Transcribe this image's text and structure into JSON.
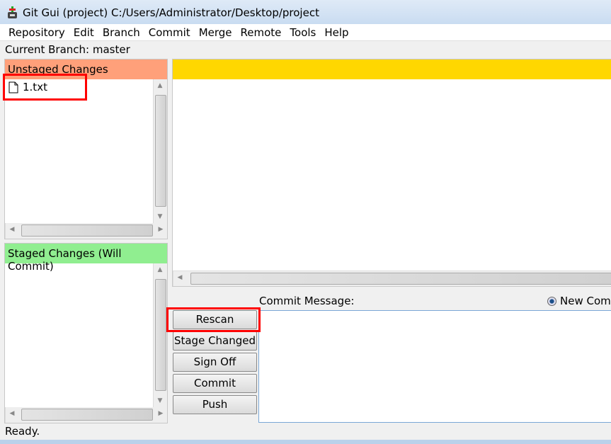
{
  "window": {
    "title": "Git Gui (project) C:/Users/Administrator/Desktop/project"
  },
  "menu": [
    "Repository",
    "Edit",
    "Branch",
    "Commit",
    "Merge",
    "Remote",
    "Tools",
    "Help"
  ],
  "branch_label": "Current Branch: master",
  "unstaged": {
    "header": "Unstaged Changes",
    "files": [
      "1.txt"
    ],
    "color": "#ffa07a"
  },
  "staged": {
    "header": "Staged Changes (Will Commit)",
    "color": "#90ee90"
  },
  "diff": {
    "header_color": "#ffd700"
  },
  "commit": {
    "label": "Commit Message:",
    "radio_label": "New Commit",
    "message": ""
  },
  "buttons": [
    "Rescan",
    "Stage Changed",
    "Sign Off",
    "Commit",
    "Push"
  ],
  "status": "Ready."
}
